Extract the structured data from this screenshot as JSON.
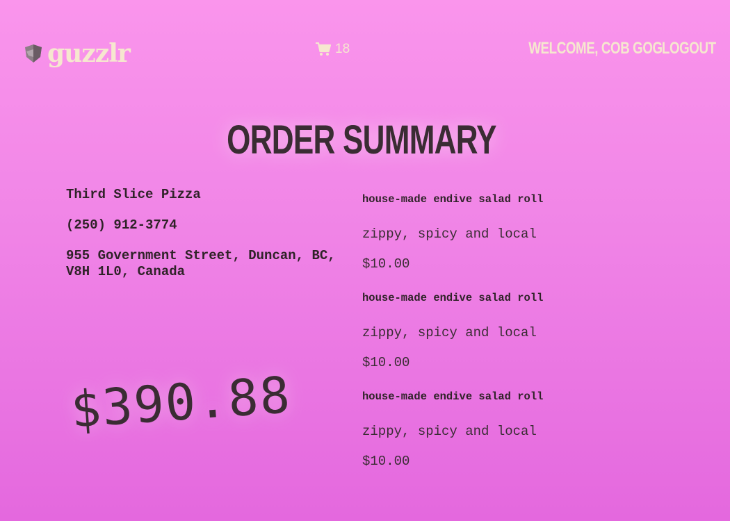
{
  "header": {
    "brand": "guzzlr",
    "cart_count": "18",
    "welcome": "WELCOME, COB GOG",
    "logout": "LOGOUT"
  },
  "page": {
    "title": "ORDER SUMMARY"
  },
  "restaurant": {
    "name": "Third Slice Pizza",
    "phone": "(250) 912-3774",
    "address_line1": "955 Government Street, Duncan, BC,",
    "address_line2": "V8H 1L0, Canada"
  },
  "order": {
    "total": "$390.88",
    "items": [
      {
        "name": "house-made endive salad roll",
        "description": "zippy, spicy and local",
        "price": "$10.00"
      },
      {
        "name": "house-made endive salad roll",
        "description": "zippy, spicy and local",
        "price": "$10.00"
      },
      {
        "name": "house-made endive salad roll",
        "description": "zippy, spicy and local",
        "price": "$10.00"
      }
    ]
  },
  "icons": {
    "logo": "shield-logo-icon",
    "cart": "shopping-cart-icon"
  },
  "colors": {
    "background_top": "#fa95ec",
    "background_bottom": "#e468de",
    "header_text": "#f6e7cf",
    "body_text": "#3a2c33"
  }
}
